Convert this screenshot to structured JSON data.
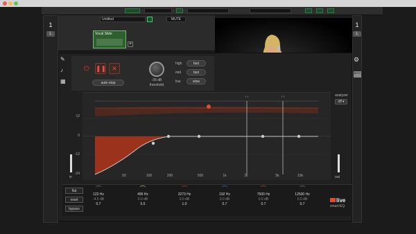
{
  "colors": {
    "accent": "#e04e2c",
    "curve": "#c8c8c8",
    "fill": "#a8341c",
    "green": "#3bd06b"
  },
  "track": {
    "name": "Untitled",
    "mute": "MUTE",
    "clip_name": "Vocal Slide",
    "seg2": "0000000",
    "seg3": "0"
  },
  "side": {
    "left_num": "1",
    "right_num": "1",
    "left_btn": "L",
    "right_btn": "L"
  },
  "plugin": {
    "threshold_value": "-35 dB",
    "threshold_label": "threshold",
    "auto_stop": "auto-stop",
    "attack_rows": [
      {
        "label": "high",
        "value": "fast"
      },
      {
        "label": "mid",
        "value": "fast"
      },
      {
        "label": "low",
        "value": "slow"
      }
    ],
    "db_select": "24",
    "analyzer_label": "analyzer",
    "analyzer_value": "off",
    "in_label": "in",
    "out_label": "out",
    "yticks": [
      "12",
      "",
      "",
      "",
      "0",
      "",
      "",
      "",
      "-12",
      "",
      "",
      "",
      "-24"
    ],
    "xticks": [
      "50",
      "100",
      "200",
      "500",
      "1k",
      "2k",
      "5k",
      "10k"
    ]
  },
  "buttons": {
    "flat": "flat",
    "reset": "reset",
    "bypass": "bypass"
  },
  "bands": [
    {
      "freq": "122 Hz",
      "gain": "-4.5 dB",
      "q": "0.7"
    },
    {
      "freq": "495 Hz",
      "gain": "0.0 dB",
      "q": "5.5"
    },
    {
      "freq": "3273 Hz",
      "gain": "0.0 dB",
      "q": "1.0"
    },
    {
      "freq": "192 Hz",
      "gain": "0.0 dB",
      "q": "0.7"
    },
    {
      "freq": "7500 Hz",
      "gain": "0.0 dB",
      "q": "0.7"
    },
    {
      "freq": "12500 Hz",
      "gain": "0.0 dB",
      "q": "0.7"
    }
  ],
  "brand": {
    "name": "live",
    "sub": "smart:EQ"
  }
}
